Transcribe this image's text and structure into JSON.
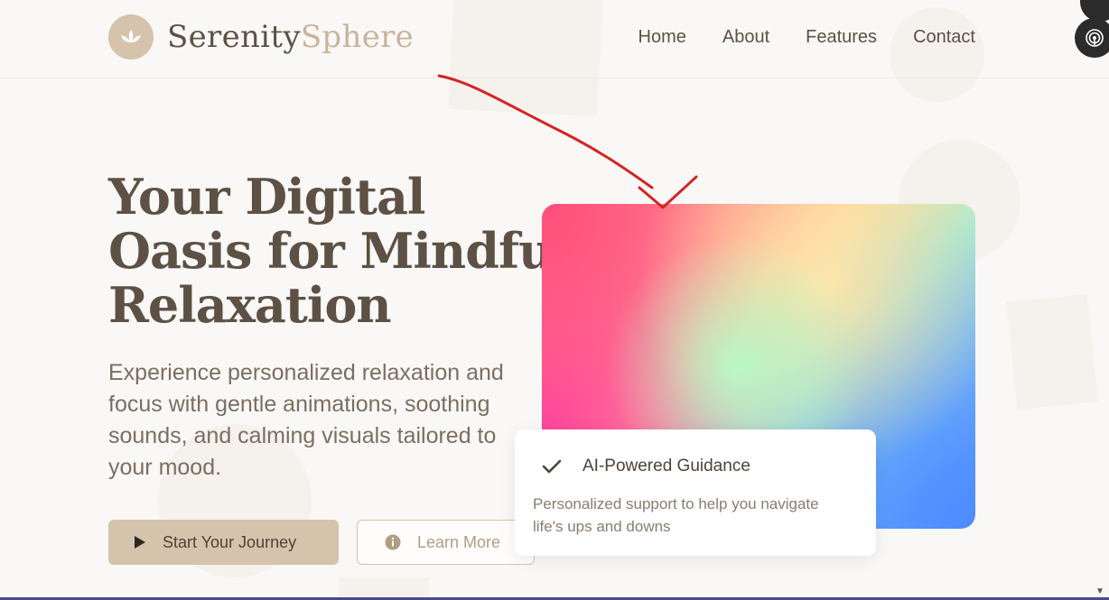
{
  "brand": {
    "name_part1": "Serenity",
    "name_part2": "Sphere",
    "color_primary": "#5d5145",
    "color_accent": "#c7b49b",
    "logo_icon": "lotus-icon"
  },
  "nav": {
    "items": [
      {
        "label": "Home"
      },
      {
        "label": "About"
      },
      {
        "label": "Features"
      },
      {
        "label": "Contact"
      }
    ]
  },
  "hero": {
    "title_line1": "Your Digital",
    "title_line2": "Oasis for Mindful",
    "title_line3": "Relaxation",
    "description": "Experience personalized relaxation and focus with gentle animations, soothing sounds, and calming visuals tailored to your mood.",
    "primary_button": {
      "label": "Start Your Journey",
      "icon": "play-icon"
    },
    "secondary_button": {
      "label": "Learn More",
      "icon": "info-icon"
    }
  },
  "feature_card": {
    "icon": "check-icon",
    "title": "AI-Powered Guidance",
    "description": "Personalized support to help you navigate life's ups and downs"
  },
  "floating_buttons": [
    {
      "icon": "dark-circle-icon"
    },
    {
      "icon": "broadcast-icon"
    }
  ]
}
